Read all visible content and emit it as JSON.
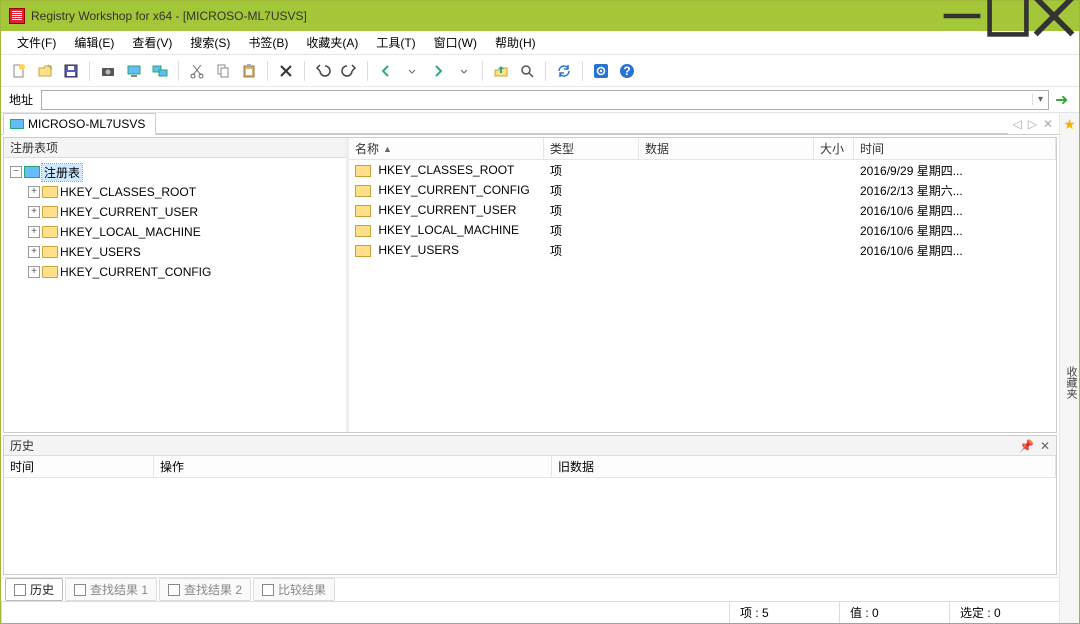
{
  "title": "Registry Workshop for x64 - [MICROSO-ML7USVS]",
  "menu": [
    "文件(F)",
    "编辑(E)",
    "查看(V)",
    "搜索(S)",
    "书签(B)",
    "收藏夹(A)",
    "工具(T)",
    "窗口(W)",
    "帮助(H)"
  ],
  "address": {
    "label": "地址",
    "value": ""
  },
  "tab": {
    "label": "MICROSO-ML7USVS"
  },
  "sidebar_label": "收藏夹",
  "tree": {
    "header": "注册表项",
    "root": "注册表",
    "children": [
      "HKEY_CLASSES_ROOT",
      "HKEY_CURRENT_USER",
      "HKEY_LOCAL_MACHINE",
      "HKEY_USERS",
      "HKEY_CURRENT_CONFIG"
    ]
  },
  "list": {
    "columns": {
      "name": "名称",
      "type": "类型",
      "data": "数据",
      "size": "大小",
      "time": "时间"
    },
    "rows": [
      {
        "name": "HKEY_CLASSES_ROOT",
        "type": "项",
        "data": "",
        "size": "",
        "time": "2016/9/29 星期四..."
      },
      {
        "name": "HKEY_CURRENT_CONFIG",
        "type": "项",
        "data": "",
        "size": "",
        "time": "2016/2/13 星期六..."
      },
      {
        "name": "HKEY_CURRENT_USER",
        "type": "项",
        "data": "",
        "size": "",
        "time": "2016/10/6 星期四..."
      },
      {
        "name": "HKEY_LOCAL_MACHINE",
        "type": "项",
        "data": "",
        "size": "",
        "time": "2016/10/6 星期四..."
      },
      {
        "name": "HKEY_USERS",
        "type": "项",
        "data": "",
        "size": "",
        "time": "2016/10/6 星期四..."
      }
    ]
  },
  "history": {
    "title": "历史",
    "columns": {
      "time": "时间",
      "op": "操作",
      "old": "旧数据"
    }
  },
  "bottom_tabs": [
    "历史",
    "查找结果 1",
    "查找结果 2",
    "比较结果"
  ],
  "status": {
    "items": "项 : 5",
    "values": "值 : 0",
    "selected": "选定 : 0"
  }
}
